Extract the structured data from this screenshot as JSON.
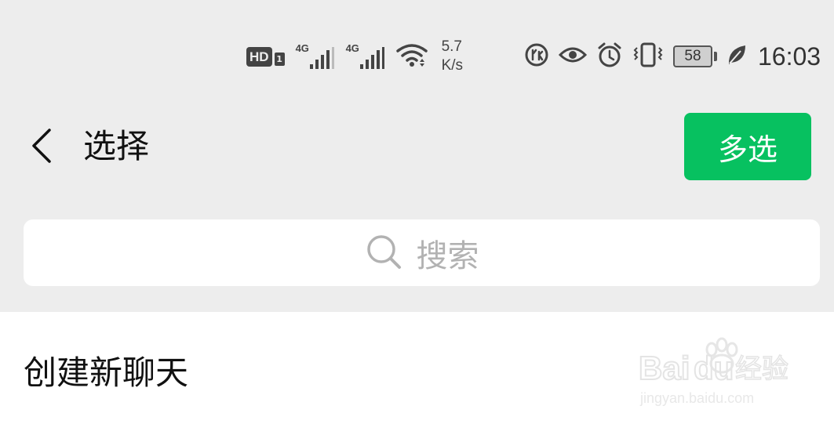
{
  "status_bar": {
    "hd_label": "HD",
    "hd_sub_label": "1",
    "signal_1_network": "4G",
    "signal_2_network": "4G",
    "speed_value": "5.7",
    "speed_unit": "K/s",
    "battery_level": "58",
    "time": "16:03",
    "icons": [
      "hd-volte-icon",
      "signal-icon",
      "signal-icon",
      "wifi-icon",
      "data-saver-icon",
      "eye-comfort-icon",
      "alarm-icon",
      "vibrate-icon",
      "battery-icon",
      "power-saving-leaf-icon"
    ]
  },
  "header": {
    "title": "选择",
    "multi_select_label": "多选",
    "accent_color": "#07c160"
  },
  "search": {
    "placeholder": "搜索"
  },
  "list": {
    "new_chat_label": "创建新聊天"
  },
  "watermark": {
    "brand": "Baidu经验",
    "url": "jingyan.baidu.com"
  }
}
